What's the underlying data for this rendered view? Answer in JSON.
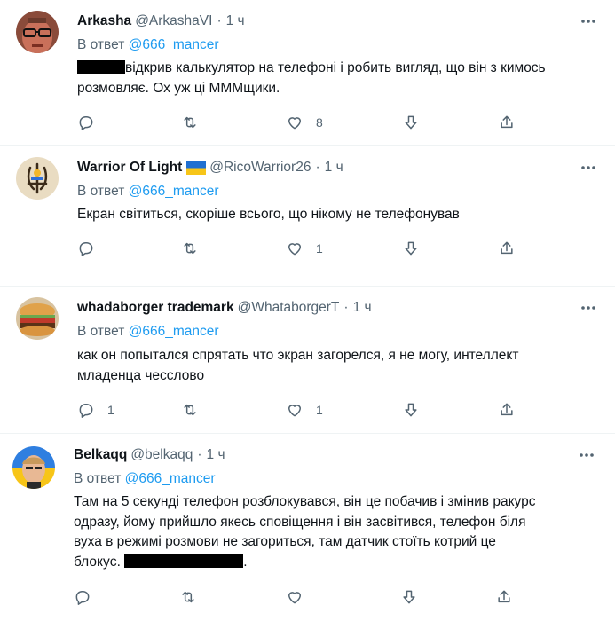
{
  "tweets": [
    {
      "name": "Arkasha",
      "handle": "@ArkashaVI",
      "sep": "·",
      "time": "1 ч",
      "reply_prefix": "В ответ",
      "reply_to": "@666_mancer",
      "text_line1": "відкрив калькулятор на телефоні і робить вигляд, що він з кимось",
      "text_line2": "розмовляє. Ох уж ці МММщики.",
      "reply_count": "",
      "retweet_count": "",
      "like_count": "8"
    },
    {
      "name": "Warrior Of Light",
      "handle": "@RicoWarrior26",
      "sep": "·",
      "time": "1 ч",
      "reply_prefix": "В ответ",
      "reply_to": "@666_mancer",
      "text_line1": "Екран світиться, скоріше всього, що нікому не телефонував",
      "reply_count": "",
      "retweet_count": "",
      "like_count": "1"
    },
    {
      "name": "whadaborger trademark",
      "handle": "@WhataborgerT",
      "sep": "·",
      "time": "1 ч",
      "reply_prefix": "В ответ",
      "reply_to": "@666_mancer",
      "text_line1": "как он попытался спрятать что экран загорелся, я не могу, интеллект",
      "text_line2": "младенца чесслово",
      "reply_count": "1",
      "retweet_count": "",
      "like_count": "1"
    },
    {
      "name": "Belkaqq",
      "handle": "@belkaqq",
      "sep": "·",
      "time": "1 ч",
      "reply_prefix": "В ответ",
      "reply_to": "@666_mancer",
      "text_line1": "Там на 5 секунді телефон розблокувався, він це побачив і змінив ракурс",
      "text_line2": "одразу, йому прийшло якесь сповіщення і він засвітився, телефон біля",
      "text_line3": "вуха в режимі розмови не загориться, там датчик стоїть котрий це",
      "text_line4": "блокує.",
      "text_end": ".",
      "reply_count": "",
      "retweet_count": "",
      "like_count": ""
    }
  ],
  "icons": {
    "more": "more-icon",
    "reply": "reply-icon",
    "retweet": "retweet-icon",
    "like": "like-icon",
    "downvote": "downvote-icon",
    "share": "share-icon"
  },
  "colors": {
    "text": "#0f1419",
    "muted": "#536471",
    "link": "#1d9bf0",
    "divider": "#eff3f4"
  }
}
